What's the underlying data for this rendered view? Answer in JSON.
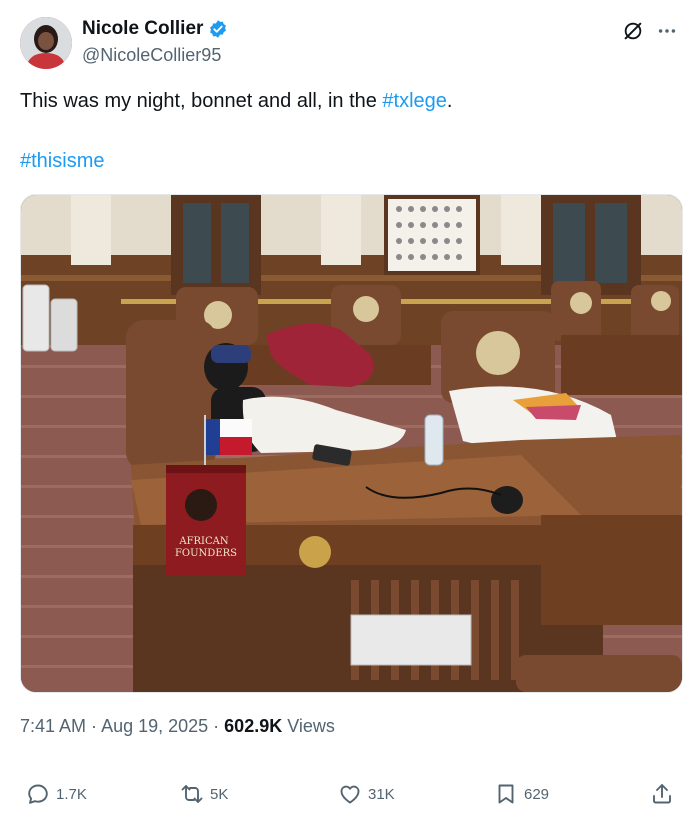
{
  "author": {
    "display_name": "Nicole Collier",
    "handle": "@NicoleCollier95",
    "verified": true
  },
  "tweet": {
    "text_prefix": "This was my night, bonnet and all, in the ",
    "hashtag1": "#txlege",
    "text_suffix": ".",
    "hashtag2": "#thisisme"
  },
  "photo": {
    "book_title_line1": "AFRICAN",
    "book_title_line2": "FOUNDERS"
  },
  "meta": {
    "time": "7:41 AM",
    "separator1": " · ",
    "date": "Aug 19, 2025",
    "separator2": " · ",
    "views_count": "602.9K",
    "views_label": " Views"
  },
  "actions": {
    "replies": "1.7K",
    "reposts": "5K",
    "likes": "31K",
    "bookmarks": "629"
  },
  "colors": {
    "accent": "#1d9bf0",
    "muted": "#536471",
    "text": "#0f1419"
  },
  "icons": [
    "verified-badge-icon",
    "grok-icon",
    "more-icon",
    "reply-icon",
    "repost-icon",
    "like-icon",
    "bookmark-icon",
    "share-icon"
  ]
}
